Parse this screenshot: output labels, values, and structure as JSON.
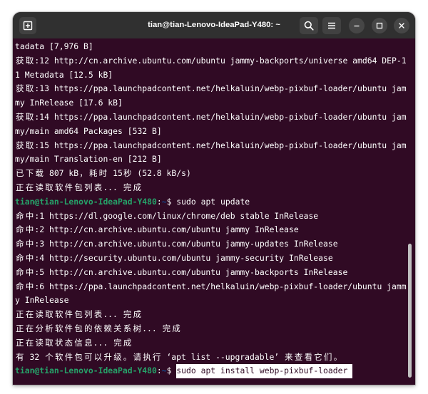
{
  "window": {
    "title": "tian@tian-Lenovo-IdeaPad-Y480: ~"
  },
  "icons": {
    "new_tab": "new-tab-icon",
    "search": "search-icon",
    "menu": "hamburger-menu-icon",
    "minimize": "minimize-icon",
    "maximize": "maximize-icon",
    "close": "close-icon"
  },
  "colors": {
    "headerbar": "#303030",
    "terminal_background": "#300a24",
    "terminal_text": "#ffffff",
    "prompt_user_host": "#26a269",
    "prompt_cwd": "#12488b",
    "selection_background": "#ffffff",
    "selection_text": "#300a24",
    "cursor": "#ffffff",
    "scrollbar_thumb": "#c0c0c0"
  },
  "terminal": {
    "prompt": {
      "user_host": "tian@tian-Lenovo-IdeaPad-Y480",
      "separator": ":",
      "cwd": "~",
      "symbol": "$"
    },
    "lines": [
      {
        "text": "tadata [7,976 B]"
      },
      {
        "text": "获取:12 http://cn.archive.ubuntu.com/ubuntu jammy-backports/universe amd64 DEP-1"
      },
      {
        "text": "1 Metadata [12.5 kB]"
      },
      {
        "text": "获取:13 https://ppa.launchpadcontent.net/helkaluin/webp-pixbuf-loader/ubuntu jam"
      },
      {
        "text": "my InRelease [17.6 kB]"
      },
      {
        "text": "获取:14 https://ppa.launchpadcontent.net/helkaluin/webp-pixbuf-loader/ubuntu jam"
      },
      {
        "text": "my/main amd64 Packages [532 B]"
      },
      {
        "text": "获取:15 https://ppa.launchpadcontent.net/helkaluin/webp-pixbuf-loader/ubuntu jam"
      },
      {
        "text": "my/main Translation-en [212 B]"
      },
      {
        "text": "已下载 807 kB，耗时 15秒 (52.8 kB/s)"
      },
      {
        "text": "正在读取软件包列表... 完成"
      },
      {
        "command": "sudo apt update"
      },
      {
        "text": "命中:1 https://dl.google.com/linux/chrome/deb stable InRelease"
      },
      {
        "text": "命中:2 http://cn.archive.ubuntu.com/ubuntu jammy InRelease"
      },
      {
        "text": "命中:3 http://cn.archive.ubuntu.com/ubuntu jammy-updates InRelease"
      },
      {
        "text": "命中:4 http://security.ubuntu.com/ubuntu jammy-security InRelease"
      },
      {
        "text": "命中:5 http://cn.archive.ubuntu.com/ubuntu jammy-backports InRelease"
      },
      {
        "text": "命中:6 https://ppa.launchpadcontent.net/helkaluin/webp-pixbuf-loader/ubuntu jamm"
      },
      {
        "text": "y InRelease"
      },
      {
        "text": "正在读取软件包列表... 完成"
      },
      {
        "text": "正在分析软件包的依赖关系树... 完成"
      },
      {
        "text": "正在读取状态信息... 完成"
      },
      {
        "text": "有 32 个软件包可以升级。请执行 ‘apt list --upgradable’ 来查看它们。"
      },
      {
        "command": "sudo apt install webp-pixbuf-loader",
        "selected": true
      }
    ],
    "scrollbar": {
      "visible_fraction": 0.4,
      "scroll_fraction": 1.0
    }
  }
}
